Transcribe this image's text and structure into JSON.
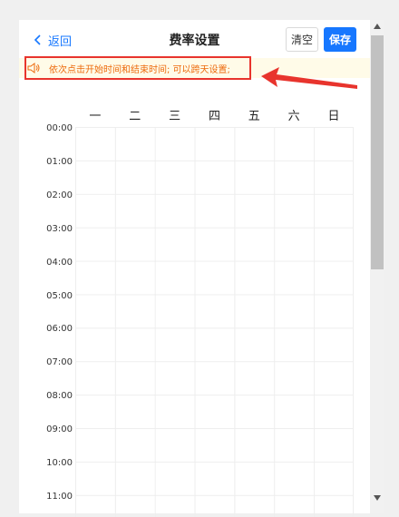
{
  "header": {
    "back_label": "返回",
    "title": "费率设置",
    "clear_label": "清空",
    "save_label": "保存"
  },
  "notice": {
    "text": "依次点击开始时间和结束时间; 可以跨天设置;",
    "icon": "speaker-icon"
  },
  "schedule": {
    "days": [
      "一",
      "二",
      "三",
      "四",
      "五",
      "六",
      "日"
    ],
    "times": [
      "00:00",
      "01:00",
      "02:00",
      "03:00",
      "04:00",
      "05:00",
      "06:00",
      "07:00",
      "08:00",
      "09:00",
      "10:00",
      "11:00"
    ]
  },
  "colors": {
    "accent": "#1677ff",
    "notice_text": "#ed6a0c",
    "notice_bg": "#fffbe8",
    "annotation": "#e8342d"
  }
}
